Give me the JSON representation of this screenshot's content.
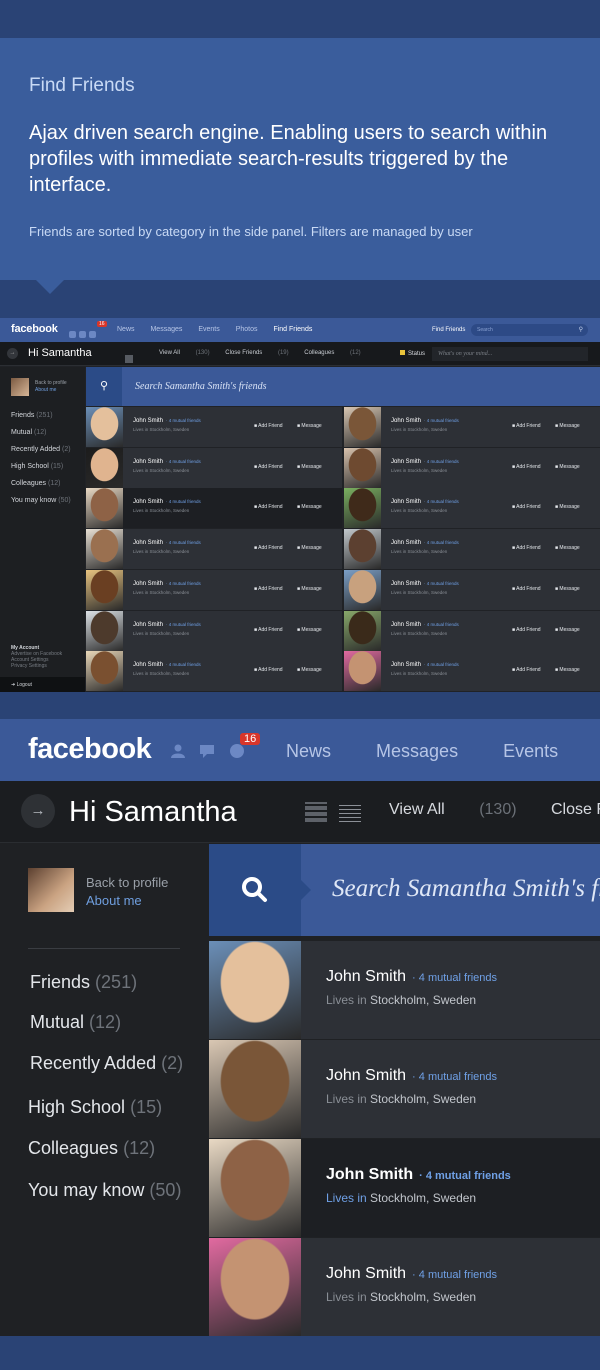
{
  "intro": {
    "title": "Find Friends",
    "lead": "Ajax driven search engine. Enabling users to search within profiles with immediate search-results triggered by the interface.",
    "note": "Friends are sorted by category in the side panel. Filters are managed by user"
  },
  "nav": {
    "logo": "facebook",
    "badge": "16",
    "links": [
      "News",
      "Messages",
      "Events",
      "Photos",
      "Find Friends"
    ],
    "find_label": "Find Friends",
    "search_placeholder": "Search"
  },
  "top": {
    "greeting": "Hi Samantha",
    "tabs": [
      {
        "label": "View All",
        "count": "(130)"
      },
      {
        "label": "Close Friends",
        "count": "(19)"
      },
      {
        "label": "Colleagues",
        "count": "(12)"
      }
    ],
    "status_label": "Status",
    "mind_placeholder": "What's on your mind..."
  },
  "sidebar": {
    "back": "Back to profile",
    "about": "About me",
    "categories": [
      {
        "label": "Friends",
        "count": "(251)"
      },
      {
        "label": "Mutual",
        "count": "(12)"
      },
      {
        "label": "Recently Added",
        "count": "(2)"
      },
      {
        "label": "High School",
        "count": "(15)"
      },
      {
        "label": "Colleagues",
        "count": "(12)"
      },
      {
        "label": "You may know",
        "count": "(50)"
      }
    ],
    "account": {
      "title": "My Account",
      "links": [
        "Advertise on Facebook",
        "Account Settings",
        "Privacy Settings"
      ]
    },
    "logout": "Logout"
  },
  "search": {
    "text": "Search Samantha Smith's friends"
  },
  "friend": {
    "name": "John Smith",
    "mutual": "· 4 mutual friends",
    "lives_in": "Lives in",
    "location": "Stockholm, Sweden",
    "add": "Add Friend",
    "message": "Message"
  },
  "colors": {
    "brand": "#3b5998",
    "link": "#6fa0e6",
    "badge": "#d8362a"
  }
}
